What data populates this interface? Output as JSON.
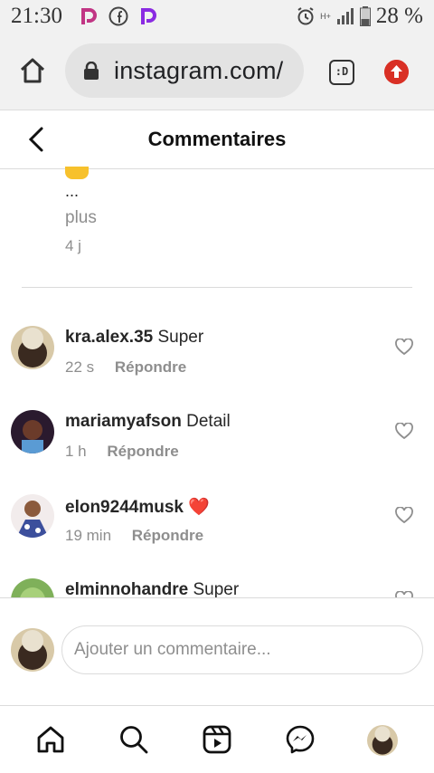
{
  "status_bar": {
    "time": "21:30",
    "battery_percent": "28 %",
    "network": "H+"
  },
  "browser": {
    "url": "instagram.com/",
    "tab_badge": ":D"
  },
  "header": {
    "title": "Commentaires"
  },
  "caption": {
    "ellipsis": "...",
    "more_label": "plus",
    "age": "4 j"
  },
  "comments": [
    {
      "username": "kra.alex.35",
      "text": "Super",
      "age": "22 s",
      "reply_label": "Répondre"
    },
    {
      "username": "mariamyafson",
      "text": "Detail",
      "age": "1 h",
      "reply_label": "Répondre"
    },
    {
      "username": "elon9244musk",
      "text": "❤️",
      "age": "19 min",
      "reply_label": "Répondre"
    },
    {
      "username": "elminnohandre",
      "text": "Super",
      "age": "",
      "reply_label": ""
    }
  ],
  "composer": {
    "placeholder": "Ajouter un commentaire..."
  },
  "colors": {
    "heart_red": "#e0245e",
    "upload_red": "#d93025",
    "muted_text": "#8e8e8e"
  }
}
